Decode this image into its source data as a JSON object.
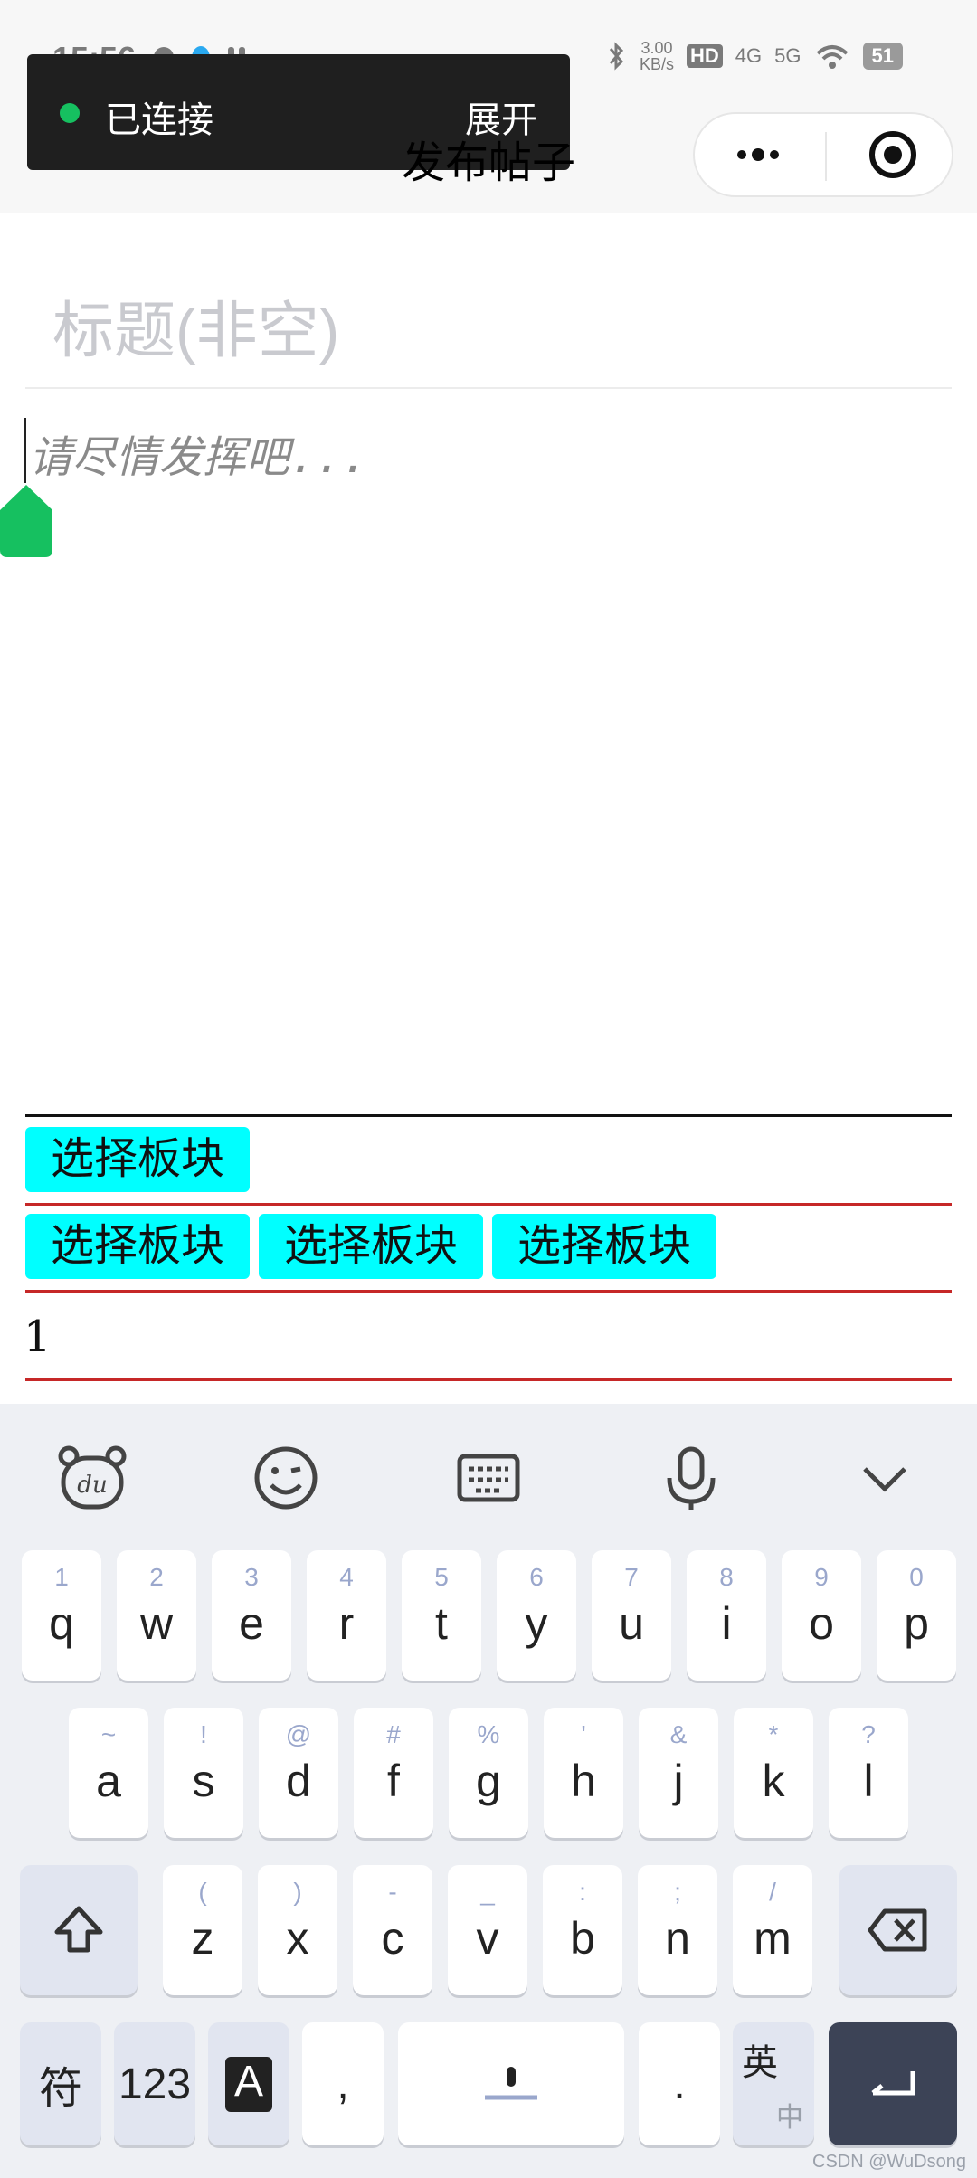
{
  "status_bar": {
    "time": "15:56",
    "net_speed_value": "3.00",
    "net_speed_unit": "KB/s",
    "hd_label": "HD",
    "sig1_label": "4G",
    "sig2_label": "5G",
    "battery": "51"
  },
  "toast": {
    "label": "已连接",
    "expand": "展开"
  },
  "header": {
    "title": "发布帖子"
  },
  "form": {
    "title_placeholder": "标题(非空)",
    "body_placeholder": "请尽情发挥吧..."
  },
  "sections": {
    "select_label": "选择板块",
    "selected_chips": [
      "选择板块",
      "选择板块",
      "选择板块"
    ],
    "count": "1"
  },
  "keyboard": {
    "row1": [
      {
        "hint": "1",
        "key": "q"
      },
      {
        "hint": "2",
        "key": "w"
      },
      {
        "hint": "3",
        "key": "e"
      },
      {
        "hint": "4",
        "key": "r"
      },
      {
        "hint": "5",
        "key": "t"
      },
      {
        "hint": "6",
        "key": "y"
      },
      {
        "hint": "7",
        "key": "u"
      },
      {
        "hint": "8",
        "key": "i"
      },
      {
        "hint": "9",
        "key": "o"
      },
      {
        "hint": "0",
        "key": "p"
      }
    ],
    "row2": [
      {
        "hint": "~",
        "key": "a"
      },
      {
        "hint": "!",
        "key": "s"
      },
      {
        "hint": "@",
        "key": "d"
      },
      {
        "hint": "#",
        "key": "f"
      },
      {
        "hint": "%",
        "key": "g"
      },
      {
        "hint": "'",
        "key": "h"
      },
      {
        "hint": "&",
        "key": "j"
      },
      {
        "hint": "*",
        "key": "k"
      },
      {
        "hint": "?",
        "key": "l"
      }
    ],
    "row3": [
      {
        "hint": "(",
        "key": "z"
      },
      {
        "hint": ")",
        "key": "x"
      },
      {
        "hint": "-",
        "key": "c"
      },
      {
        "hint": "_",
        "key": "v"
      },
      {
        "hint": ":",
        "key": "b"
      },
      {
        "hint": ";",
        "key": "n"
      },
      {
        "hint": "/",
        "key": "m"
      }
    ],
    "symbols_key": "符",
    "numbers_key": "123",
    "font_key": "A",
    "comma_key": ",",
    "period_key": ".",
    "lang_top": "英",
    "lang_bottom": "中"
  },
  "watermark": "CSDN @WuDsong",
  "colors": {
    "accent": "#16c060",
    "chip": "#00ffff",
    "divider_red": "#c62828",
    "enter_key": "#3c4356"
  }
}
